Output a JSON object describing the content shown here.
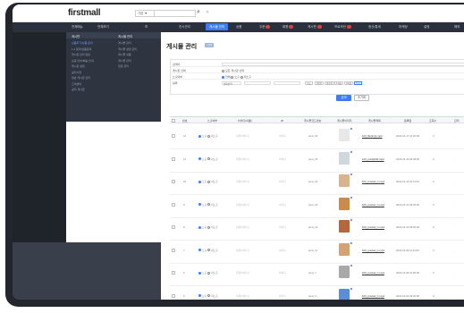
{
  "app": {
    "logo": "firstmall",
    "search_scope": "기본 ▼",
    "search_placeholder": ""
  },
  "nav": {
    "left1": "전체메뉴",
    "left2": "전체보기",
    "left_toggle": "☰",
    "items": [
      {
        "label": "전시관리",
        "active": false,
        "badge": false
      },
      {
        "label": "게시물 관리",
        "active": true,
        "badge": false
      },
      {
        "label": "상품",
        "active": false,
        "badge": false
      },
      {
        "label": "주문",
        "active": false,
        "badge": true
      },
      {
        "label": "회원",
        "active": false,
        "badge": true
      },
      {
        "label": "게시판",
        "active": false,
        "badge": true
      },
      {
        "label": "프로모션",
        "active": false,
        "badge": true
      },
      {
        "label": "정산/통계",
        "active": false,
        "badge": false
      },
      {
        "label": "마케팅",
        "active": false,
        "badge": false
      },
      {
        "label": "설정",
        "active": false,
        "badge": false
      },
      {
        "label": "해외",
        "active": false,
        "badge": false
      }
    ]
  },
  "submenu": {
    "col1_title": "게시판",
    "col2_title": "게시물 관리",
    "col1_items": [
      "상품후기/상품 문의",
      "1:1 문의/상품문의",
      "게시판 관리 일반",
      "쇼핑 안내/배송 안내",
      "게시판 설정",
      "공지사항",
      "일반 게시판 관리",
      "고객센터",
      "공지 게시판"
    ],
    "col2_items": [
      "게시물 관리",
      "게시물 설정 관리",
      "게시물 상품",
      "게시물 관리",
      "댓글 관리"
    ]
  },
  "page": {
    "title": "게시물 관리",
    "title_tag": "도움말"
  },
  "filters": {
    "keyword_label": "검색어",
    "board_label": "게시판 선택",
    "board_option": "모든 게시판 선택",
    "status_label": "노출여부",
    "status_options": [
      "전체",
      "노출",
      "미노출"
    ],
    "date_label": "날짜",
    "date_type": "날짜선택",
    "date_buttons": [
      "오늘",
      "3일간",
      "일주일",
      "1개월",
      "3개월",
      "전체"
    ],
    "search_button": "검색",
    "reset_button": "초기화"
  },
  "table": {
    "headers": [
      "번호",
      "노출여부",
      "아이디(이름)",
      "ID",
      "게시물코드번호",
      "게시물이미지",
      "게시물제목",
      "등록일",
      "조회수",
      "관리"
    ],
    "rows": [
      {
        "num": "12",
        "user": "회원(아이디)",
        "id": "아이디",
        "code": "prod_33",
        "title": "123_file(tmp).mp4",
        "date": "2024-01-17 10:20:00",
        "views": "0",
        "thumb_color": "#e8e8e8"
      },
      {
        "num": "11",
        "user": "회원(아이디)",
        "id": "아이디",
        "code": "prod_31",
        "title": "123_prod(123).mp4",
        "date": "2024-01-16 09:48:00",
        "views": "0",
        "thumb_color": "#cfd8dc"
      },
      {
        "num": "10",
        "user": "회원(아이디)",
        "id": "아이디",
        "code": "prod_24",
        "title": "100_product_1.mp4",
        "date": "2024-01-15 10:11:00",
        "views": "0",
        "thumb_color": "#d9b38c"
      },
      {
        "num": "9",
        "user": "회원(아이디)",
        "id": "아이디",
        "code": "prod_19",
        "title": "100_product_1.mp4",
        "date": "2024-01-12 09:05:00",
        "views": "0",
        "thumb_color": "#c98a4b"
      },
      {
        "num": "8",
        "user": "회원(아이디)",
        "id": "아이디",
        "code": "prod_14",
        "title": "100_product_1.mp4",
        "date": "2024-01-10 08:30:00",
        "views": "0",
        "thumb_color": "#b7653a"
      },
      {
        "num": "7",
        "user": "회원(아이디)",
        "id": "아이디",
        "code": "prod_11",
        "title": "100_product_1.mp4",
        "date": "2024-01-09 11:12:00",
        "views": "0",
        "thumb_color": "#d4a373"
      },
      {
        "num": "6",
        "user": "회원(아이디)",
        "id": "아이디",
        "code": "prod_7",
        "title": "100_product_1.mp4",
        "date": "2024-01-05 10:00:00",
        "views": "0",
        "thumb_color": "#a9a9a9"
      },
      {
        "num": "5",
        "user": "회원(아이디)",
        "id": "아이디",
        "code": "prod_3",
        "title": "100_product_1.mp4",
        "date": "2024-01-02 09:00:00",
        "views": "0",
        "thumb_color": "#5a8fd6"
      }
    ],
    "status_options": [
      "노출",
      "미노출"
    ]
  },
  "colors": {
    "accent": "#3d7bf7",
    "nav_bg": "#2b313c",
    "sidebar_bg": "#1f232a"
  }
}
